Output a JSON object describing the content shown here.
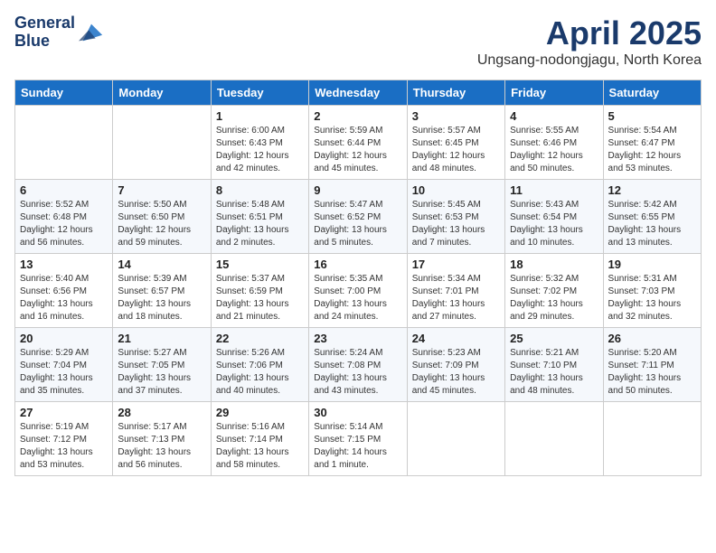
{
  "header": {
    "logo_line1": "General",
    "logo_line2": "Blue",
    "month_title": "April 2025",
    "subtitle": "Ungsang-nodongjagu, North Korea"
  },
  "weekdays": [
    "Sunday",
    "Monday",
    "Tuesday",
    "Wednesday",
    "Thursday",
    "Friday",
    "Saturday"
  ],
  "weeks": [
    [
      {
        "day": "",
        "info": ""
      },
      {
        "day": "",
        "info": ""
      },
      {
        "day": "1",
        "info": "Sunrise: 6:00 AM\nSunset: 6:43 PM\nDaylight: 12 hours\nand 42 minutes."
      },
      {
        "day": "2",
        "info": "Sunrise: 5:59 AM\nSunset: 6:44 PM\nDaylight: 12 hours\nand 45 minutes."
      },
      {
        "day": "3",
        "info": "Sunrise: 5:57 AM\nSunset: 6:45 PM\nDaylight: 12 hours\nand 48 minutes."
      },
      {
        "day": "4",
        "info": "Sunrise: 5:55 AM\nSunset: 6:46 PM\nDaylight: 12 hours\nand 50 minutes."
      },
      {
        "day": "5",
        "info": "Sunrise: 5:54 AM\nSunset: 6:47 PM\nDaylight: 12 hours\nand 53 minutes."
      }
    ],
    [
      {
        "day": "6",
        "info": "Sunrise: 5:52 AM\nSunset: 6:48 PM\nDaylight: 12 hours\nand 56 minutes."
      },
      {
        "day": "7",
        "info": "Sunrise: 5:50 AM\nSunset: 6:50 PM\nDaylight: 12 hours\nand 59 minutes."
      },
      {
        "day": "8",
        "info": "Sunrise: 5:48 AM\nSunset: 6:51 PM\nDaylight: 13 hours\nand 2 minutes."
      },
      {
        "day": "9",
        "info": "Sunrise: 5:47 AM\nSunset: 6:52 PM\nDaylight: 13 hours\nand 5 minutes."
      },
      {
        "day": "10",
        "info": "Sunrise: 5:45 AM\nSunset: 6:53 PM\nDaylight: 13 hours\nand 7 minutes."
      },
      {
        "day": "11",
        "info": "Sunrise: 5:43 AM\nSunset: 6:54 PM\nDaylight: 13 hours\nand 10 minutes."
      },
      {
        "day": "12",
        "info": "Sunrise: 5:42 AM\nSunset: 6:55 PM\nDaylight: 13 hours\nand 13 minutes."
      }
    ],
    [
      {
        "day": "13",
        "info": "Sunrise: 5:40 AM\nSunset: 6:56 PM\nDaylight: 13 hours\nand 16 minutes."
      },
      {
        "day": "14",
        "info": "Sunrise: 5:39 AM\nSunset: 6:57 PM\nDaylight: 13 hours\nand 18 minutes."
      },
      {
        "day": "15",
        "info": "Sunrise: 5:37 AM\nSunset: 6:59 PM\nDaylight: 13 hours\nand 21 minutes."
      },
      {
        "day": "16",
        "info": "Sunrise: 5:35 AM\nSunset: 7:00 PM\nDaylight: 13 hours\nand 24 minutes."
      },
      {
        "day": "17",
        "info": "Sunrise: 5:34 AM\nSunset: 7:01 PM\nDaylight: 13 hours\nand 27 minutes."
      },
      {
        "day": "18",
        "info": "Sunrise: 5:32 AM\nSunset: 7:02 PM\nDaylight: 13 hours\nand 29 minutes."
      },
      {
        "day": "19",
        "info": "Sunrise: 5:31 AM\nSunset: 7:03 PM\nDaylight: 13 hours\nand 32 minutes."
      }
    ],
    [
      {
        "day": "20",
        "info": "Sunrise: 5:29 AM\nSunset: 7:04 PM\nDaylight: 13 hours\nand 35 minutes."
      },
      {
        "day": "21",
        "info": "Sunrise: 5:27 AM\nSunset: 7:05 PM\nDaylight: 13 hours\nand 37 minutes."
      },
      {
        "day": "22",
        "info": "Sunrise: 5:26 AM\nSunset: 7:06 PM\nDaylight: 13 hours\nand 40 minutes."
      },
      {
        "day": "23",
        "info": "Sunrise: 5:24 AM\nSunset: 7:08 PM\nDaylight: 13 hours\nand 43 minutes."
      },
      {
        "day": "24",
        "info": "Sunrise: 5:23 AM\nSunset: 7:09 PM\nDaylight: 13 hours\nand 45 minutes."
      },
      {
        "day": "25",
        "info": "Sunrise: 5:21 AM\nSunset: 7:10 PM\nDaylight: 13 hours\nand 48 minutes."
      },
      {
        "day": "26",
        "info": "Sunrise: 5:20 AM\nSunset: 7:11 PM\nDaylight: 13 hours\nand 50 minutes."
      }
    ],
    [
      {
        "day": "27",
        "info": "Sunrise: 5:19 AM\nSunset: 7:12 PM\nDaylight: 13 hours\nand 53 minutes."
      },
      {
        "day": "28",
        "info": "Sunrise: 5:17 AM\nSunset: 7:13 PM\nDaylight: 13 hours\nand 56 minutes."
      },
      {
        "day": "29",
        "info": "Sunrise: 5:16 AM\nSunset: 7:14 PM\nDaylight: 13 hours\nand 58 minutes."
      },
      {
        "day": "30",
        "info": "Sunrise: 5:14 AM\nSunset: 7:15 PM\nDaylight: 14 hours\nand 1 minute."
      },
      {
        "day": "",
        "info": ""
      },
      {
        "day": "",
        "info": ""
      },
      {
        "day": "",
        "info": ""
      }
    ]
  ]
}
